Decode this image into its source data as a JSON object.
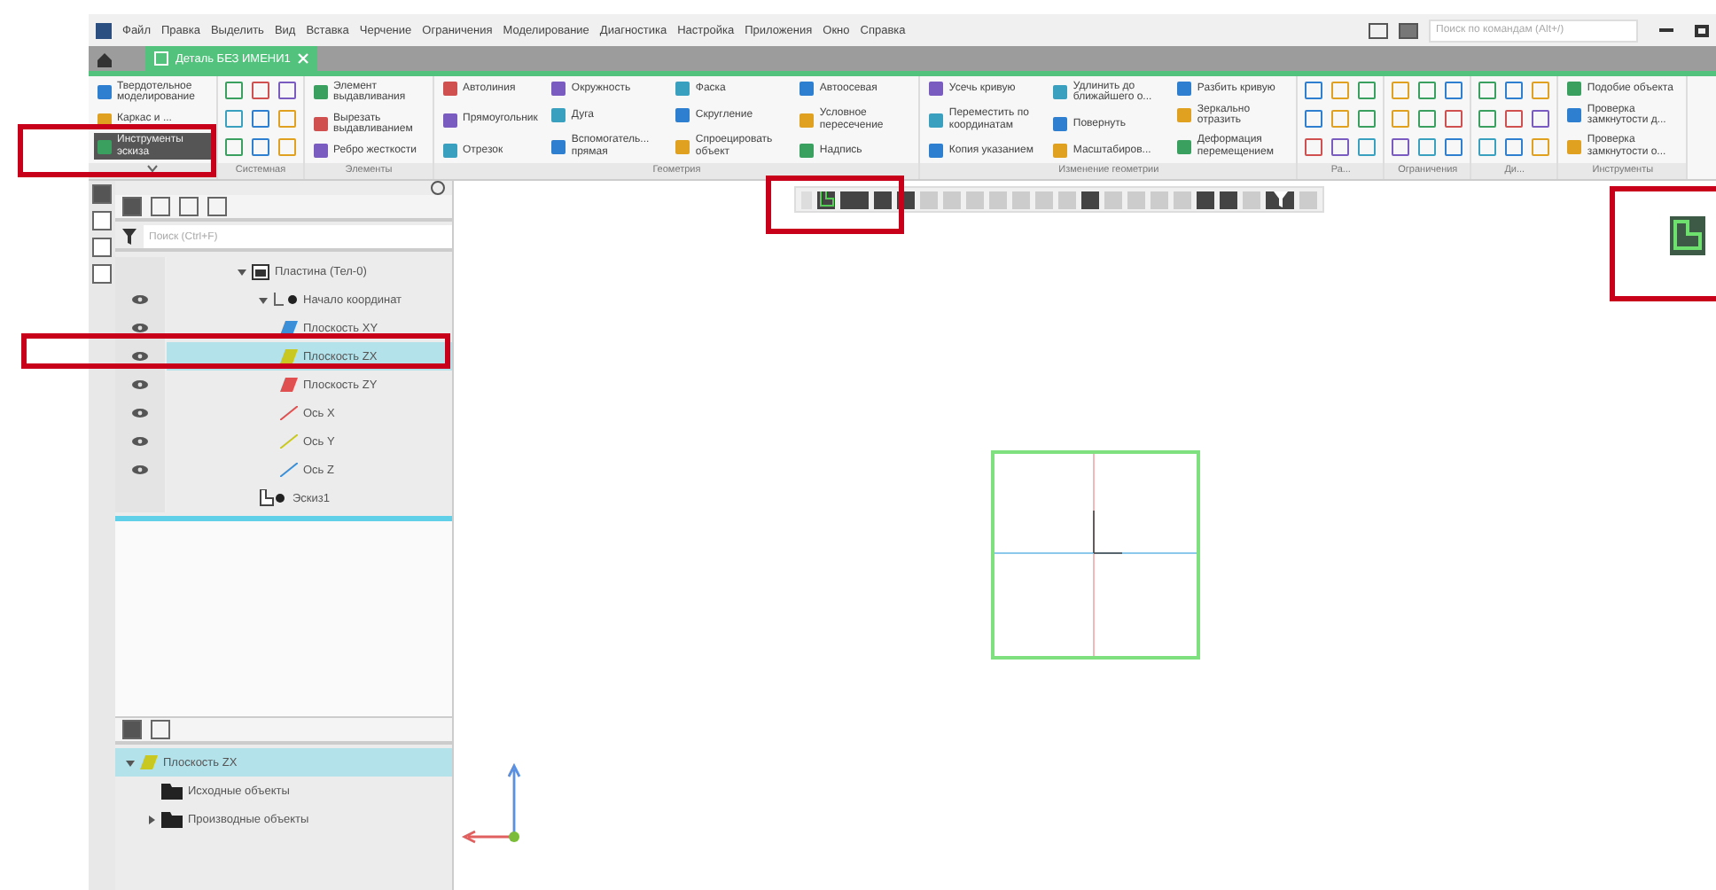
{
  "menu": [
    "Файл",
    "Правка",
    "Выделить",
    "Вид",
    "Вставка",
    "Черчение",
    "Ограничения",
    "Моделирование",
    "Диагностика",
    "Настройка",
    "Приложения",
    "Окно",
    "Справка"
  ],
  "command_search": {
    "placeholder": "Поиск по командам (Alt+/)"
  },
  "tabs": [
    {
      "label": "Деталь БЕЗ ИМЕНИ1",
      "selected": true
    }
  ],
  "ribbon": [
    {
      "kind": "text",
      "columns": [
        [
          {
            "label": "Твердотельное моделирование",
            "selected": false
          },
          {
            "label": "Каркас и ...",
            "selected": false
          },
          {
            "label": "Инструменты эскиза",
            "selected": true
          }
        ]
      ]
    },
    {
      "kind": "icons",
      "label": "Системная"
    },
    {
      "kind": "text",
      "label": "Элементы",
      "columns": [
        [
          {
            "label": "Элемент выдавливания",
            "selected": false
          },
          {
            "label": "Вырезать выдавливанием",
            "selected": false
          },
          {
            "label": "Ребро жесткости",
            "selected": false
          }
        ]
      ]
    },
    {
      "kind": "text",
      "label": "Геометрия",
      "columns": [
        [
          {
            "label": "Автолиния",
            "selected": false
          },
          {
            "label": "Прямоугольник",
            "selected": false
          },
          {
            "label": "Отрезок",
            "selected": false
          }
        ],
        [
          {
            "label": "Окружность",
            "selected": false
          },
          {
            "label": "Дуга",
            "selected": false
          },
          {
            "label": "Вспомогатель... прямая",
            "selected": false
          }
        ],
        [
          {
            "label": "Фаска",
            "selected": false
          },
          {
            "label": "Скругление",
            "selected": false
          },
          {
            "label": "Спроецировать объект",
            "selected": false
          }
        ],
        [
          {
            "label": "Автоосевая",
            "selected": false
          },
          {
            "label": "Условное пересечение",
            "selected": false
          },
          {
            "label": "Надпись",
            "selected": false
          }
        ]
      ]
    },
    {
      "kind": "text",
      "label": "Изменение геометрии",
      "columns": [
        [
          {
            "label": "Усечь кривую",
            "selected": false
          },
          {
            "label": "Переместить по координатам",
            "selected": false
          },
          {
            "label": "Копия указанием",
            "selected": false
          }
        ],
        [
          {
            "label": "Удлинить до ближайшего о...",
            "selected": false
          },
          {
            "label": "Повернуть",
            "selected": false
          },
          {
            "label": "Масштабиров...",
            "selected": false
          }
        ],
        [
          {
            "label": "Разбить кривую",
            "selected": false
          },
          {
            "label": "Зеркально отразить",
            "selected": false
          },
          {
            "label": "Деформация перемещением",
            "selected": false
          }
        ]
      ]
    },
    {
      "kind": "icons",
      "label": "Ра..."
    },
    {
      "kind": "icons",
      "label": "Ограничения"
    },
    {
      "kind": "icons",
      "label": "Ди..."
    },
    {
      "kind": "text",
      "label": "Инструменты",
      "columns": [
        [
          {
            "label": "Подобие объекта",
            "selected": false
          },
          {
            "label": "Проверка замкнутости д...",
            "selected": false
          },
          {
            "label": "Проверка замкнутости о...",
            "selected": false
          }
        ]
      ]
    }
  ],
  "tree_search": {
    "placeholder": "Поиск (Ctrl+F)"
  },
  "tree": [
    {
      "label": "Пластина (Тел-0)",
      "kind": "part",
      "visible": false,
      "selected": false,
      "expanded": true,
      "children": [
        {
          "label": "Начало координат",
          "kind": "origin",
          "visible": true,
          "selected": false,
          "expanded": true,
          "children": [
            {
              "label": "Плоскость XY",
              "kind": "plane",
              "color": "#3a8fd8",
              "visible": true,
              "selected": false
            },
            {
              "label": "Плоскость ZX",
              "kind": "plane",
              "color": "#c8c820",
              "visible": true,
              "selected": true
            },
            {
              "label": "Плоскость ZY",
              "kind": "plane",
              "color": "#e05050",
              "visible": true,
              "selected": false
            },
            {
              "label": "Ось X",
              "kind": "axis",
              "color": "#e05050",
              "visible": true,
              "selected": false
            },
            {
              "label": "Ось Y",
              "kind": "axis",
              "color": "#c8c820",
              "visible": true,
              "selected": false
            },
            {
              "label": "Ось Z",
              "kind": "axis",
              "color": "#3a8fd8",
              "visible": true,
              "selected": false
            }
          ]
        },
        {
          "label": "Эскиз1",
          "kind": "sketch",
          "visible": false,
          "selected": false
        }
      ]
    }
  ],
  "relations": [
    {
      "label": "Плоскость ZX",
      "kind": "plane",
      "color": "#c8c820",
      "selected": true,
      "expanded": true,
      "children": [
        {
          "label": "Исходные объекты",
          "kind": "folder",
          "selected": false,
          "expanded": false
        },
        {
          "label": "Производные объекты",
          "kind": "folder",
          "selected": false,
          "expanded": false
        }
      ]
    }
  ]
}
